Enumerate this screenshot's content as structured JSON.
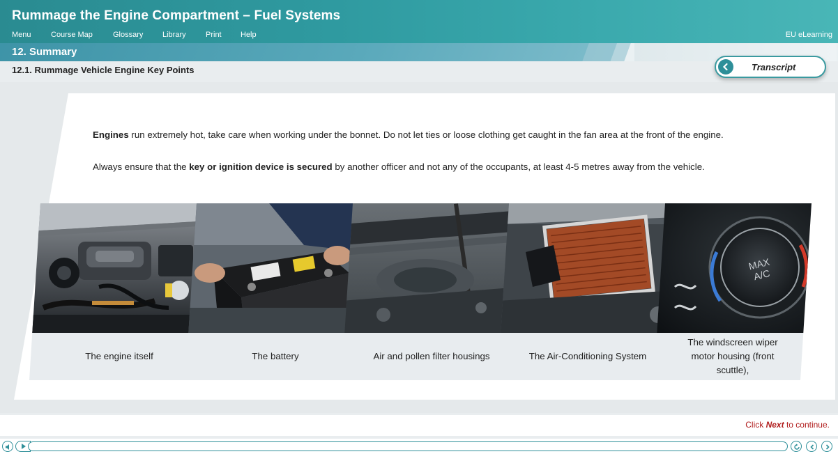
{
  "header": {
    "title": "Rummage the Engine Compartment – Fuel Systems",
    "menu": [
      "Menu",
      "Course Map",
      "Glossary",
      "Library",
      "Print",
      "Help"
    ],
    "brand": "EU eLearning"
  },
  "section": {
    "label": "12. Summary",
    "subtitle": "12.1. Rummage Vehicle Engine Key Points"
  },
  "transcript": {
    "label": "Transcript"
  },
  "content": {
    "p1_bold": "Engines",
    "p1_rest": " run extremely hot, take care when working under the bonnet. Do not let ties or loose clothing get caught in the fan area at the front of the engine.",
    "p2_start": "Always ensure that the ",
    "p2_bold": "key or ignition device is secured",
    "p2_end": " by another officer and not any of the occupants, at least 4-5 metres away from the vehicle."
  },
  "panels": [
    {
      "caption": "The engine itself"
    },
    {
      "caption": "The battery"
    },
    {
      "caption": "Air and pollen filter housings"
    },
    {
      "caption": "The Air-Conditioning System"
    },
    {
      "caption": "The windscreen wiper motor housing (front scuttle),"
    }
  ],
  "knob_text": {
    "line1": "MAX",
    "line2": "A/C"
  },
  "footer": {
    "continue_start": "Click ",
    "continue_bold": "Next",
    "continue_end": " to continue."
  },
  "colors": {
    "teal": "#2e8f99",
    "link_red": "#b11d1d"
  }
}
